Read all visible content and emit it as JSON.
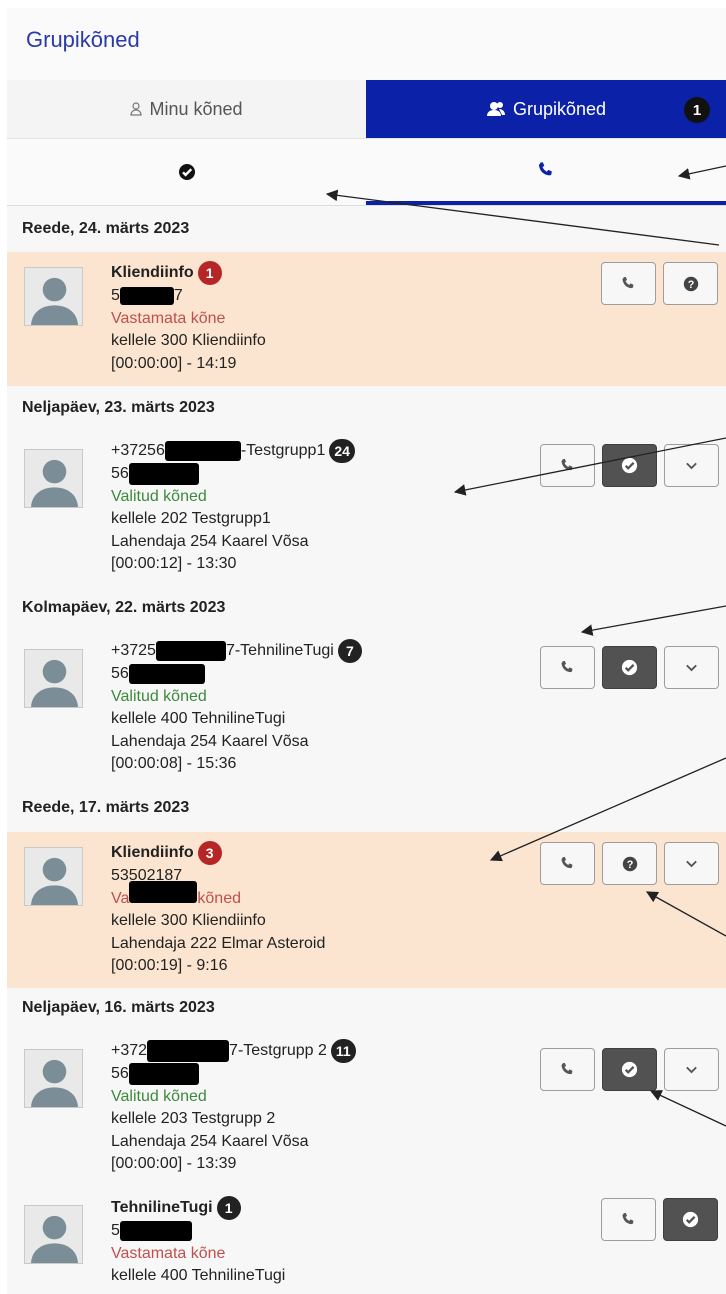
{
  "header": {
    "title": "Grupikõned"
  },
  "tabs": {
    "mine": "Minu kõned",
    "group": "Grupikõned",
    "group_count": "1"
  },
  "dates": {
    "d1": "Reede, 24. märts 2023",
    "d2": "Neljapäev, 23. märts 2023",
    "d3": "Kolmapäev, 22. märts 2023",
    "d4": "Reede, 17. märts 2023",
    "d5": "Neljapäev, 16. märts 2023"
  },
  "calls": [
    {
      "name": "Kliendiinfo",
      "count": "1",
      "number_prefix": "5",
      "number_suffix": "7",
      "status": "Vastamata kõne",
      "to": "kellele 300 Kliendiinfo",
      "time": "[00:00:00] - 14:19"
    },
    {
      "name_prefix": "+37256",
      "name_suffix": "-Testgrupp1",
      "count": "24",
      "number_prefix": "56",
      "status": "Valitud kõned",
      "to": "kellele 202 Testgrupp1",
      "handler": "Lahendaja 254 Kaarel Võsa",
      "time": "[00:00:12] - 13:30"
    },
    {
      "name_prefix": "+3725",
      "name_suffix": "7-TehnilineTugi",
      "count": "7",
      "number_prefix": "56",
      "status": "Valitud kõned",
      "to": "kellele 400 TehnilineTugi",
      "handler": "Lahendaja 254 Kaarel Võsa",
      "time": "[00:00:08] - 15:36"
    },
    {
      "name": "Kliendiinfo",
      "count": "3",
      "number": "53502187",
      "status_suffix": "kõned",
      "to": "kellele 300 Kliendiinfo",
      "handler": "Lahendaja 222 Elmar Asteroid",
      "time": "[00:00:19] - 9:16"
    },
    {
      "name_prefix": "+372",
      "name_suffix": "7-Testgrupp 2",
      "count": "11",
      "number_prefix": "56",
      "status": "Valitud kõned",
      "to": "kellele 203 Testgrupp 2",
      "handler": "Lahendaja 254 Kaarel Võsa",
      "time": "[00:00:00] - 13:39"
    },
    {
      "name": "TehnilineTugi",
      "count": "1",
      "number_prefix": "5",
      "status": "Vastamata kõne",
      "to": "kellele 400 TehnilineTugi"
    }
  ],
  "icons": {
    "user": "user-outline-icon",
    "group": "users-icon",
    "check": "check-circle-icon",
    "phone": "phone-icon",
    "question": "question-circle-icon",
    "chevron": "chevron-down-icon",
    "avatar": "avatar-placeholder-icon"
  },
  "colors": {
    "accent": "#0b21a7",
    "missed_row": "#fbe5d0",
    "missed_text": "#c0504d",
    "answered_text": "#3c8a3c",
    "badge_red": "#b72626"
  }
}
